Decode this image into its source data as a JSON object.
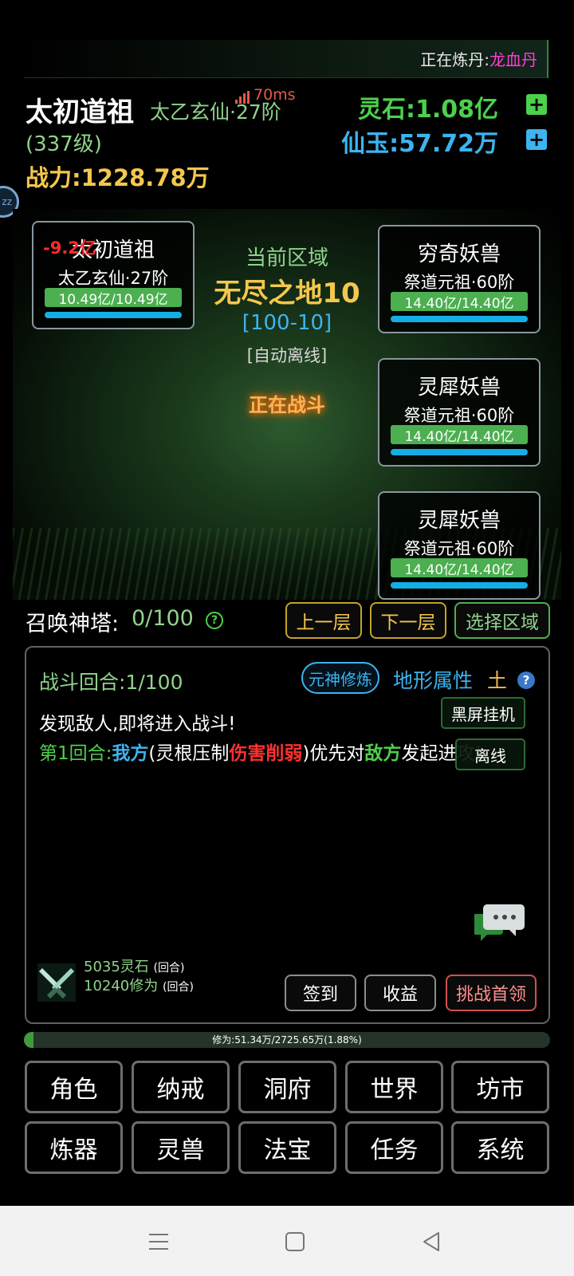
{
  "alchemy": {
    "label": "正在炼丹:",
    "value": "龙血丹"
  },
  "player": {
    "name": "太初道祖",
    "realm": "太乙玄仙·27阶",
    "level": "(337级)",
    "power": "战力:1228.78万"
  },
  "ping": "70ms",
  "currency": {
    "stone": "灵石:1.08亿",
    "jade": "仙玉:57.72万",
    "plus": "+"
  },
  "zz_label": "zz",
  "battle": {
    "area_label": "当前区域",
    "area_name": "无尽之地10",
    "area_range": "[100-10]",
    "area_mode": "[自动离线]",
    "status": "正在战斗",
    "player_card": {
      "damage": "-9.2亿",
      "name": "太初道祖",
      "realm": "太乙玄仙·27阶",
      "hp": "10.49亿/10.49亿"
    },
    "enemies": [
      {
        "name": "穷奇妖兽",
        "realm": "祭道元祖·60阶",
        "hp": "14.40亿/14.40亿"
      },
      {
        "name": "灵犀妖兽",
        "realm": "祭道元祖·60阶",
        "hp": "14.40亿/14.40亿"
      },
      {
        "name": "灵犀妖兽",
        "realm": "祭道元祖·60阶",
        "hp": "14.40亿/14.40亿"
      }
    ]
  },
  "tower": {
    "label": "召唤神塔:",
    "value": "0/100",
    "help": "?"
  },
  "floor_buttons": {
    "prev": "上一层",
    "next": "下一层",
    "select": "选择区域"
  },
  "log": {
    "round_label": "战斗回合:1/100",
    "yuanshen": "元神修炼",
    "terrain_label": "地形属性",
    "terrain_value": "土",
    "terrain_help": "?",
    "line1": "发现敌人,即将进入战斗!",
    "line2": {
      "p1": "第1回合:",
      "p2": "我方",
      "p3": "(灵根压制",
      "p4": "伤害削弱",
      "p5": ")优先对",
      "p6": "敌方",
      "p7": "发起进攻!"
    },
    "side_buttons": {
      "black_screen": "黑屏挂机",
      "offline": "离线"
    },
    "rewards": {
      "stone": "5035灵石",
      "stone_sub": "(回合)",
      "cultivation": "10240修为",
      "cultivation_sub": "(回合)"
    },
    "buttons": {
      "checkin": "签到",
      "income": "收益",
      "boss": "挑战首领"
    }
  },
  "xp": {
    "text": "修为:51.34万/2725.65万(1.88%)",
    "fraction": 0.0188
  },
  "nav": {
    "row1": [
      "角色",
      "纳戒",
      "洞府",
      "世界",
      "坊市"
    ],
    "row2": [
      "炼器",
      "灵兽",
      "法宝",
      "任务",
      "系统"
    ]
  },
  "colors": {
    "green": "#4dd04b",
    "blue": "#3db4f0",
    "gold": "#f4c74d",
    "red": "#ff3030",
    "magenta": "#ff3fd5"
  }
}
